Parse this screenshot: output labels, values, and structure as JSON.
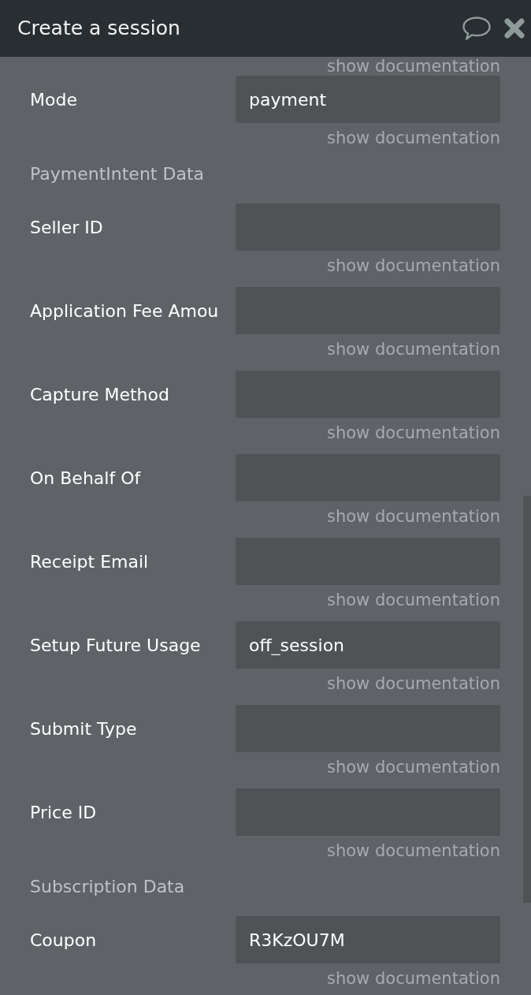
{
  "window": {
    "title": "Create a session"
  },
  "form": {
    "items": [
      {
        "kind": "doc_link",
        "text": "show documentation"
      },
      {
        "kind": "field",
        "label": "Mode",
        "value": "payment",
        "doc": "show documentation"
      },
      {
        "kind": "section",
        "text": "PaymentIntent Data"
      },
      {
        "kind": "field",
        "label": "Seller ID",
        "doc": "show documentation"
      },
      {
        "kind": "field",
        "label": "Application Fee Amou",
        "doc": "show documentation"
      },
      {
        "kind": "field",
        "label": "Capture Method",
        "doc": "show documentation"
      },
      {
        "kind": "field",
        "label": "On Behalf Of",
        "doc": "show documentation"
      },
      {
        "kind": "field",
        "label": "Receipt Email",
        "doc": "show documentation"
      },
      {
        "kind": "field",
        "label": "Setup Future Usage",
        "value": "off_session",
        "doc": "show documentation"
      },
      {
        "kind": "field",
        "label": "Submit Type",
        "doc": "show documentation"
      },
      {
        "kind": "field",
        "label": "Price ID",
        "doc": "show documentation"
      },
      {
        "kind": "section",
        "text": "Subscription Data"
      },
      {
        "kind": "field",
        "label": "Coupon",
        "value": "R3KzOU7M",
        "doc": "show documentation"
      }
    ]
  }
}
